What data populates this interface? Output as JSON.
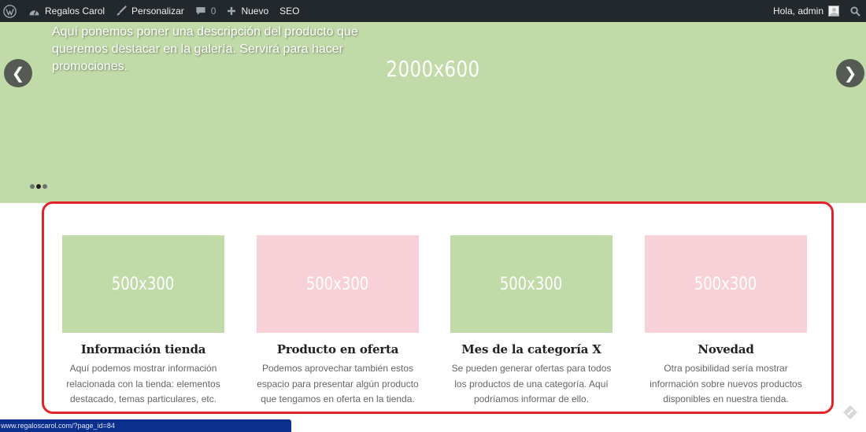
{
  "adminbar": {
    "site_name": "Regalos Carol",
    "customize": "Personalizar",
    "comments_count": "0",
    "new_label": "Nuevo",
    "seo_label": "SEO",
    "greeting": "Hola, admin"
  },
  "slider": {
    "caption": "Aquí ponemos poner una descripción del producto que queremos destacar en la galería. Servirá para hacer promociones.",
    "placeholder": "2000x600",
    "prev": "❮",
    "next": "❯",
    "dots": 3,
    "active_dot": 1,
    "background": "#c1dba8"
  },
  "features": [
    {
      "placeholder": "500x300",
      "color": "#c1dba8",
      "title": "Información tienda",
      "description": "Aquí podemos mostrar información relacionada con la tienda: elementos destacado, temas particulares, etc."
    },
    {
      "placeholder": "500x300",
      "color": "#f8d1d8",
      "title": "Producto en oferta",
      "description": "Podemos aprovechar también estos espacio para presentar algún producto que tengamos en oferta en la tienda."
    },
    {
      "placeholder": "500x300",
      "color": "#c1dba8",
      "title": "Mes de la categoría X",
      "description": "Se pueden generar ofertas para todos los productos de una categoría. Aquí podríamos informar de ello."
    },
    {
      "placeholder": "500x300",
      "color": "#f8d1d8",
      "title": "Novedad",
      "description": "Otra posibilidad sería mostrar información sobre nuevos productos disponibles en nuestra tienda."
    }
  ],
  "highlight_color": "#e2232b",
  "statusbar": {
    "url": "www.regaloscarol.com/?page_id=84"
  },
  "icons": {
    "wp_logo": "wordpress-icon",
    "site": "dashboard-icon",
    "customize": "brush-icon",
    "comments": "comment-icon",
    "new": "plus-icon",
    "search": "search-icon",
    "corner": "pencil-tag-icon"
  }
}
